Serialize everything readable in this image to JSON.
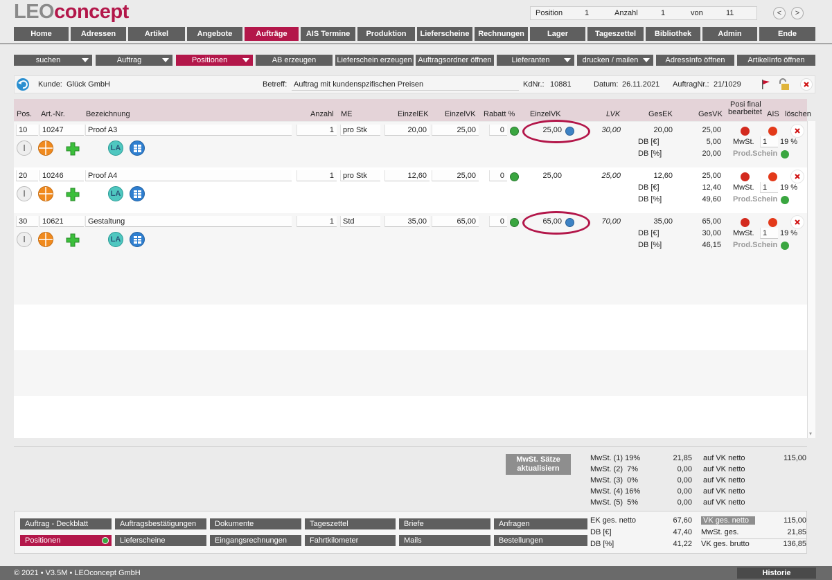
{
  "brand": {
    "leo": "LEO",
    "concept": "concept",
    "accent": "#b3174a"
  },
  "position_box": {
    "position_label": "Position",
    "position": "1",
    "anzahl_label": "Anzahl",
    "anzahl": "1",
    "von_label": "von",
    "von": "11"
  },
  "nav_prev": "<",
  "nav_next": ">",
  "main_nav": [
    "Home",
    "Adressen",
    "Artikel",
    "Angebote",
    "Aufträge",
    "AIS Termine",
    "Produktion",
    "Lieferscheine",
    "Rechnungen",
    "Lager",
    "Tageszettel",
    "Bibliothek",
    "Admin",
    "Ende"
  ],
  "main_nav_active": "Aufträge",
  "sub_nav": [
    "suchen",
    "Auftrag",
    "Positionen",
    "AB erzeugen",
    "Lieferschein erzeugen",
    "Auftragsordner öffnen",
    "Lieferanten",
    "drucken / mailen",
    "AdressInfo öffnen",
    "ArtikelInfo öffnen"
  ],
  "sub_nav_active": "Positionen",
  "info": {
    "kunde_label": "Kunde:",
    "kunde": "Glück GmbH",
    "betreff_label": "Betreff:",
    "betreff": "Auftrag mit kundenspzifischen Preisen",
    "kdnr_label": "KdNr.:",
    "kdnr": "10881",
    "datum_label": "Datum:",
    "datum": "26.11.2021",
    "auftragnr_label": "AuftragNr.:",
    "auftragnr": "21/1029"
  },
  "columns": {
    "pos": "Pos.",
    "artnr": "Art.-Nr.",
    "bez": "Bezeichnung",
    "anzahl": "Anzahl",
    "me": "ME",
    "einzelek": "EinzelEK",
    "einzelvk": "EinzelVK",
    "rabatt": "Rabatt %",
    "einzelvk2": "EinzelVK",
    "lvk": "LVK",
    "gesek": "GesEK",
    "gesvk": "GesVK",
    "posi1": "Posi final",
    "posi2": "bearbeitet",
    "ais": "AIS",
    "loeschen": "löschen"
  },
  "rows": [
    {
      "pos": "10",
      "artnr": "10247",
      "bez": "Proof A3",
      "anzahl": "1",
      "me": "pro Stk",
      "einzelek": "20,00",
      "einzelvk": "25,00",
      "rabatt": "0",
      "einzelvk2": "25,00",
      "lvk": "30,00",
      "gesek": "20,00",
      "gesvk": "25,00",
      "db_eur_label": "DB [€]",
      "db_eur": "5,00",
      "db_pct_label": "DB [%]",
      "db_pct": "20,00",
      "mwst_label": "MwSt.",
      "mwst_code": "1",
      "mwst_rate": "19 %",
      "prod": "Prod.Schein",
      "highlight": true
    },
    {
      "pos": "20",
      "artnr": "10246",
      "bez": "Proof A4",
      "anzahl": "1",
      "me": "pro Stk",
      "einzelek": "12,60",
      "einzelvk": "25,00",
      "rabatt": "0",
      "einzelvk2": "25,00",
      "lvk": "25,00",
      "gesek": "12,60",
      "gesvk": "25,00",
      "db_eur_label": "DB [€]",
      "db_eur": "12,40",
      "db_pct_label": "DB [%]",
      "db_pct": "49,60",
      "mwst_label": "MwSt.",
      "mwst_code": "1",
      "mwst_rate": "19 %",
      "prod": "Prod.Schein",
      "highlight": false
    },
    {
      "pos": "30",
      "artnr": "10621",
      "bez": "Gestaltung",
      "anzahl": "1",
      "me": "Std",
      "einzelek": "35,00",
      "einzelvk": "65,00",
      "rabatt": "0",
      "einzelvk2": "65,00",
      "lvk": "70,00",
      "gesek": "35,00",
      "gesvk": "65,00",
      "db_eur_label": "DB [€]",
      "db_eur": "30,00",
      "db_pct_label": "DB [%]",
      "db_pct": "46,15",
      "mwst_label": "MwSt.",
      "mwst_code": "1",
      "mwst_rate": "19 %",
      "prod": "Prod.Schein",
      "highlight": true
    }
  ],
  "row_icons": {
    "info": "I",
    "la": "LA"
  },
  "mwst_button": {
    "line1": "MwSt. Sätze",
    "line2": "aktualisiern"
  },
  "mwst_rows": [
    {
      "label": "MwSt. (1) 19%",
      "value": "21,85",
      "on": "auf VK netto",
      "base": "115,00"
    },
    {
      "label": "MwSt. (2)  7%",
      "value": "0,00",
      "on": "auf VK netto",
      "base": ""
    },
    {
      "label": "MwSt. (3)  0%",
      "value": "0,00",
      "on": "auf VK netto",
      "base": ""
    },
    {
      "label": "MwSt. (4) 16%",
      "value": "0,00",
      "on": "auf VK netto",
      "base": ""
    },
    {
      "label": "MwSt. (5)  5%",
      "value": "0,00",
      "on": "auf VK netto",
      "base": ""
    }
  ],
  "totals_left": [
    {
      "label": "EK ges. netto",
      "value": "67,60"
    },
    {
      "label": "DB [€]",
      "value": "47,40"
    },
    {
      "label": "DB [%]",
      "value": "41,22"
    }
  ],
  "totals_right": [
    {
      "label": "VK ges. netto",
      "value": "115,00"
    },
    {
      "label": "MwSt. ges.",
      "value": "21,85"
    },
    {
      "label": "VK ges. brutto",
      "value": "136,85"
    }
  ],
  "bottom_tabs_row1": [
    "Auftrag - Deckblatt",
    "Auftragsbestätigungen",
    "Dokumente",
    "Tageszettel",
    "Briefe",
    "Anfragen"
  ],
  "bottom_tabs_row2": [
    "Positionen",
    "Lieferscheine",
    "Eingangsrechnungen",
    "Fahrtkilometer",
    "Mails",
    "Bestellungen"
  ],
  "footer": "© 2021 • V3.5M • LEOconcept GmbH",
  "historie": "Historie"
}
